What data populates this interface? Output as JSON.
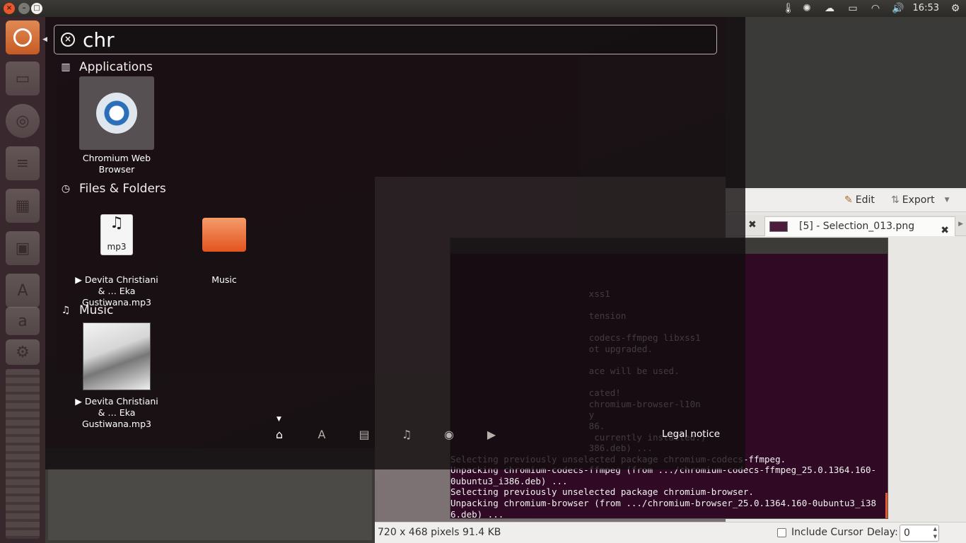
{
  "top_panel": {
    "clock": "16:53",
    "indicators": [
      "thermometer-icon",
      "sync-icon",
      "cloud-icon",
      "battery-icon",
      "wifi-icon",
      "volume-icon"
    ],
    "window_buttons": {
      "close": "×",
      "minimize": "–",
      "maximize": "□"
    }
  },
  "dash": {
    "search_value": "chr",
    "categories": {
      "applications": "Applications",
      "files_folders": "Files & Folders",
      "music": "Music"
    },
    "apps": [
      {
        "label": "Chromium Web Browser"
      }
    ],
    "files": [
      {
        "label": "▶ Devita Christiani & … Eka Gustiwana.mp3",
        "badge": "mp3"
      },
      {
        "label": "Music"
      }
    ],
    "music": [
      {
        "label": "▶ Devita Christiani & … Eka Gustiwana.mp3"
      }
    ],
    "legal_notice": "Legal notice",
    "lenses": [
      "home-lens-icon",
      "applications-lens-icon",
      "files-lens-icon",
      "music-lens-icon",
      "photos-lens-icon",
      "video-lens-icon"
    ]
  },
  "screenshot_window": {
    "toolbar": {
      "edit": "Edit",
      "export": "Export"
    },
    "tab_label": "[5] - Selection_013.png",
    "status_text": "720 x 468 pixels  91.4 KB",
    "include_cursor_label": "Include Cursor",
    "delay_label": "Delay:",
    "delay_value": "0"
  },
  "terminal": {
    "lines": [
      "",
      "",
      "",
      "                          xss1",
      "",
      "                          tension",
      "",
      "                          codecs-ffmpeg libxss1",
      "                          ot upgraded.",
      "",
      "                          ace will be used.",
      "",
      "                          cated!",
      "                          chromium-browser-l10n",
      "                          y",
      "                          86.",
      "                           currently installed.)",
      "                          386.deb) ...",
      "Selecting previously unselected package chromium-codecs-ffmpeg.",
      "Unpacking chromium-codecs-ffmpeg (from .../chromium-codecs-ffmpeg_25.0.1364.160-",
      "0ubuntu3_i386.deb) ...",
      "Selecting previously unselected package chromium-browser.",
      "Unpacking chromium-browser (from .../chromium-browser_25.0.1364.160-0ubuntu3_i38",
      "6.deb) ...",
      "█"
    ]
  }
}
